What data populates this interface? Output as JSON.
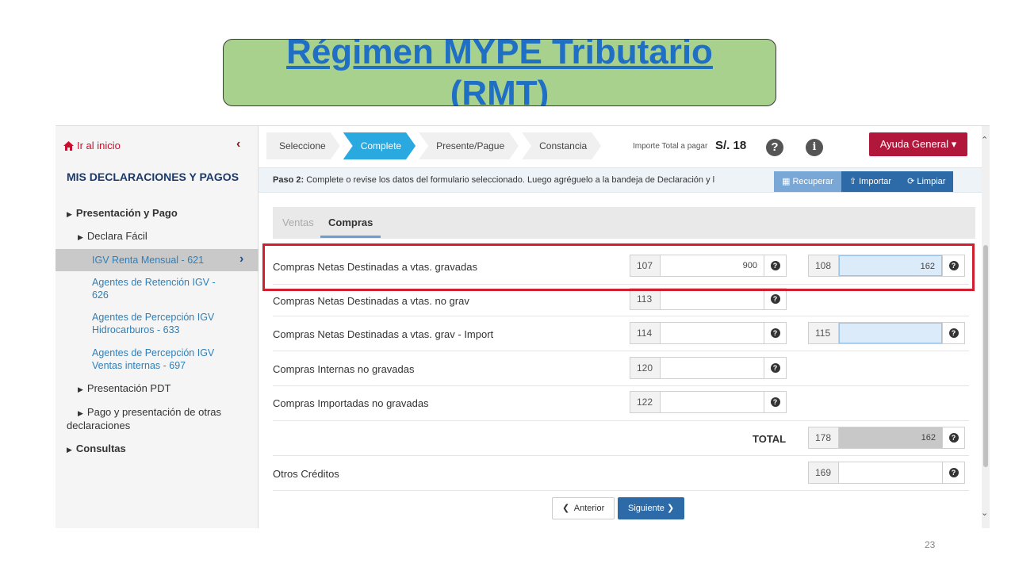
{
  "slide": {
    "title_line1": "Régimen MYPE Tributario",
    "title_line2": "(RMT)",
    "page_number": "23"
  },
  "sidebar": {
    "home": "Ir al inicio",
    "heading": "MIS DECLARACIONES Y PAGOS",
    "section_presentacion": "Presentación y Pago",
    "declara_facil": "Declara Fácil",
    "active_item": "IGV Renta Mensual - 621",
    "links": [
      "Agentes de Retención IGV - 626",
      "Agentes de Percepción IGV Hidrocarburos - 633",
      "Agentes de Percepción IGV Ventas internas - 697"
    ],
    "presentacion_pdt": "Presentación PDT",
    "pago_otras": "Pago y presentación de otras declaraciones",
    "consultas": "Consultas"
  },
  "steps": [
    "Seleccione",
    "Complete",
    "Presente/Pague",
    "Constancia"
  ],
  "header": {
    "total_label": "Importe Total a pagar",
    "total_amount": "S/. 18",
    "help_button": "Ayuda General ▾"
  },
  "infobar": {
    "step": "Paso 2:",
    "text": " Complete o revise los datos del formulario seleccionado. Luego agréguelo a la bandeja de Declaración y l",
    "recuperar": "Recuperar",
    "importar": "Importar",
    "limpiar": "Limpiar"
  },
  "tabs": {
    "ventas": "Ventas",
    "compras": "Compras"
  },
  "rows": [
    {
      "label": "Compras Netas Destinadas a vtas. gravadas",
      "code1": "107",
      "value1": "900",
      "code2": "108",
      "value2": "162"
    },
    {
      "label": "Compras Netas Destinadas a vtas. no grav",
      "code1": "113",
      "value1": ""
    },
    {
      "label": "Compras Netas Destinadas a vtas. grav - Import",
      "code1": "114",
      "value1": "",
      "code2": "115",
      "value2": ""
    },
    {
      "label": "Compras Internas no gravadas",
      "code1": "120",
      "value1": ""
    },
    {
      "label": "Compras Importadas no gravadas",
      "code1": "122",
      "value1": ""
    }
  ],
  "total_row": {
    "label": "TOTAL",
    "code": "178",
    "value": "162"
  },
  "otros_row": {
    "label": "Otros Créditos",
    "code": "169",
    "value": ""
  },
  "nav": {
    "prev": "Anterior",
    "next": "Siguiente"
  },
  "colors": {
    "title": "#1f6fc5",
    "title_bg": "#a9d18e",
    "highlight": "#d0202f",
    "active_step": "#2aa9e0",
    "help_button": "#b0173b",
    "primary_button": "#2c6aa8"
  }
}
